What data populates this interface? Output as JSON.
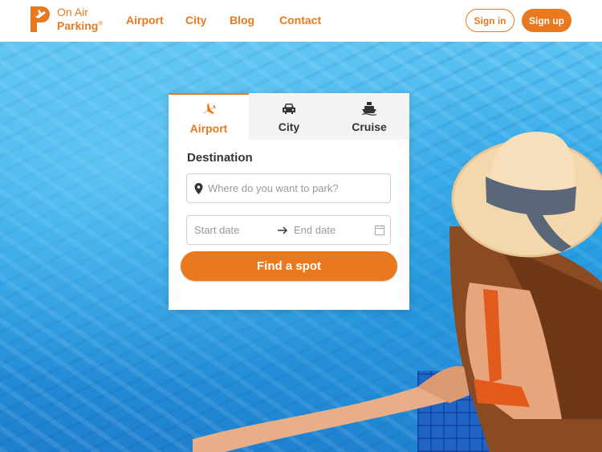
{
  "header": {
    "logo_line1": "On Air",
    "logo_line2": "Parking",
    "logo_reg": "®",
    "nav": [
      "Airport",
      "City",
      "Blog",
      "Contact"
    ],
    "signin_label": "Sign in",
    "signup_label": "Sign up"
  },
  "search": {
    "tabs": [
      {
        "label": "Airport",
        "icon": "plane-icon",
        "active": true
      },
      {
        "label": "City",
        "icon": "car-icon",
        "active": false
      },
      {
        "label": "Cruise",
        "icon": "ship-icon",
        "active": false
      }
    ],
    "destination_label": "Destination",
    "destination_placeholder": "Where do you want to park?",
    "start_date_placeholder": "Start date",
    "end_date_placeholder": "End date",
    "find_label": "Find a spot"
  },
  "colors": {
    "accent": "#e8791f",
    "text": "#333333",
    "placeholder": "#9a9a9a"
  }
}
